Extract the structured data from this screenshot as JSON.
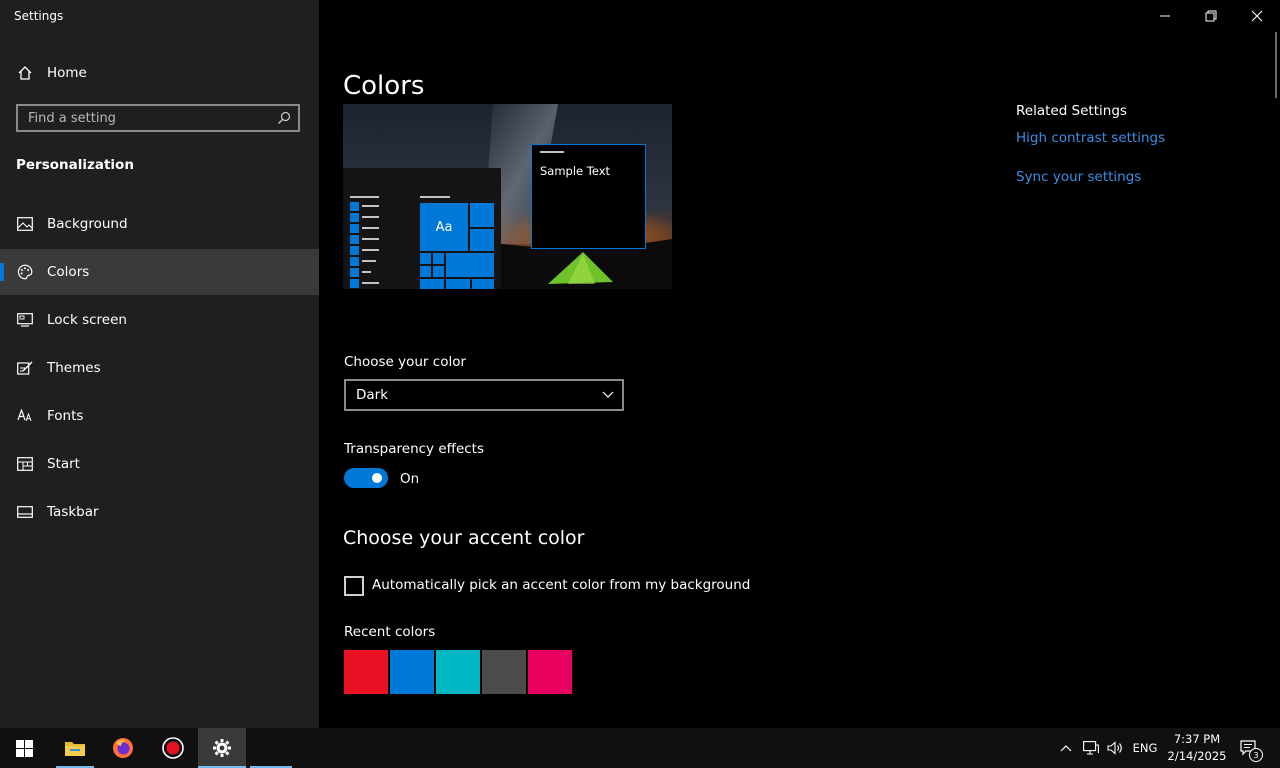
{
  "window": {
    "title": "Settings",
    "controls": {
      "minimize": "minimize-icon",
      "restore": "restore-icon",
      "close": "close-icon"
    }
  },
  "sidebar": {
    "home_label": "Home",
    "search_placeholder": "Find a setting",
    "section_title": "Personalization",
    "items": [
      {
        "label": "Background",
        "icon": "picture-icon"
      },
      {
        "label": "Colors",
        "icon": "palette-icon",
        "selected": true
      },
      {
        "label": "Lock screen",
        "icon": "lock-screen-icon"
      },
      {
        "label": "Themes",
        "icon": "themes-icon"
      },
      {
        "label": "Fonts",
        "icon": "fonts-icon"
      },
      {
        "label": "Start",
        "icon": "start-icon"
      },
      {
        "label": "Taskbar",
        "icon": "taskbar-icon"
      }
    ]
  },
  "main": {
    "title": "Colors",
    "preview": {
      "sample_text": "Sample Text",
      "tile_label": "Aa"
    },
    "choose_color": {
      "label": "Choose your color",
      "selected": "Dark"
    },
    "transparency": {
      "label": "Transparency effects",
      "state": "On",
      "enabled": true
    },
    "accent": {
      "heading": "Choose your accent color",
      "auto_pick_label": "Automatically pick an accent color from my background",
      "auto_pick_checked": false,
      "recent_label": "Recent colors",
      "recent_colors": [
        "#e81123",
        "#0078d7",
        "#00b7c3",
        "#4c4c4c",
        "#ea005e"
      ]
    }
  },
  "related": {
    "title": "Related Settings",
    "links": [
      "High contrast settings",
      "Sync your settings"
    ]
  },
  "taskbar": {
    "apps": [
      "windows-start-icon",
      "file-explorer-icon",
      "firefox-icon",
      "record-icon",
      "settings-gear-icon"
    ],
    "tray": {
      "language": "ENG",
      "time": "7:37 PM",
      "date": "2/14/2025",
      "notification_count": "3"
    }
  },
  "colors": {
    "accent": "#0078d7",
    "link": "#3b8fe3",
    "sidebar_bg": "#1f1f1f"
  }
}
